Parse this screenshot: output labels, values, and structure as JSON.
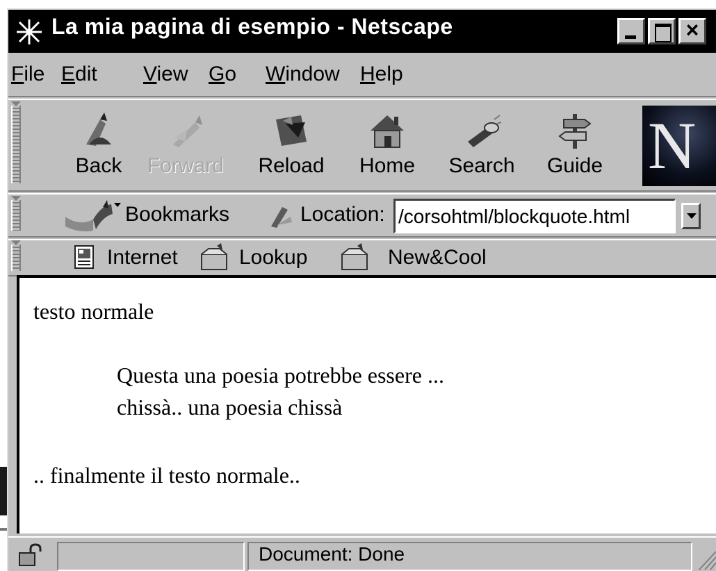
{
  "window": {
    "title": "La mia pagina di esempio - Netscape"
  },
  "menu": [
    {
      "key": "F",
      "rest": "ile"
    },
    {
      "key": "E",
      "rest": "dit"
    },
    {
      "key": "V",
      "rest": "iew"
    },
    {
      "key": "G",
      "rest": "o"
    },
    {
      "key": "W",
      "rest": "indow"
    },
    {
      "key": "H",
      "rest": "elp"
    }
  ],
  "navigation": {
    "back": "Back",
    "forward": "Forward",
    "reload": "Reload",
    "home": "Home",
    "search": "Search",
    "guide": "Guide",
    "logo_letter": "N"
  },
  "location_bar": {
    "bookmarks": "Bookmarks",
    "location_label": "Location:",
    "url": "/corsohtml/blockquote.html"
  },
  "personal_toolbar": {
    "internet": "Internet",
    "lookup": "Lookup",
    "new_cool": "New&Cool"
  },
  "content": {
    "line1": "testo normale",
    "quote_line1": "Questa una poesia potrebbe essere ...",
    "quote_line2": "chissà.. una poesia chissà",
    "line2": ".. finalmente il testo normale.."
  },
  "status": {
    "text": "Document: Done"
  },
  "colors": {
    "title_bar": "#000000",
    "chrome": "#c0c0c0",
    "content_bg": "#ffffff"
  }
}
